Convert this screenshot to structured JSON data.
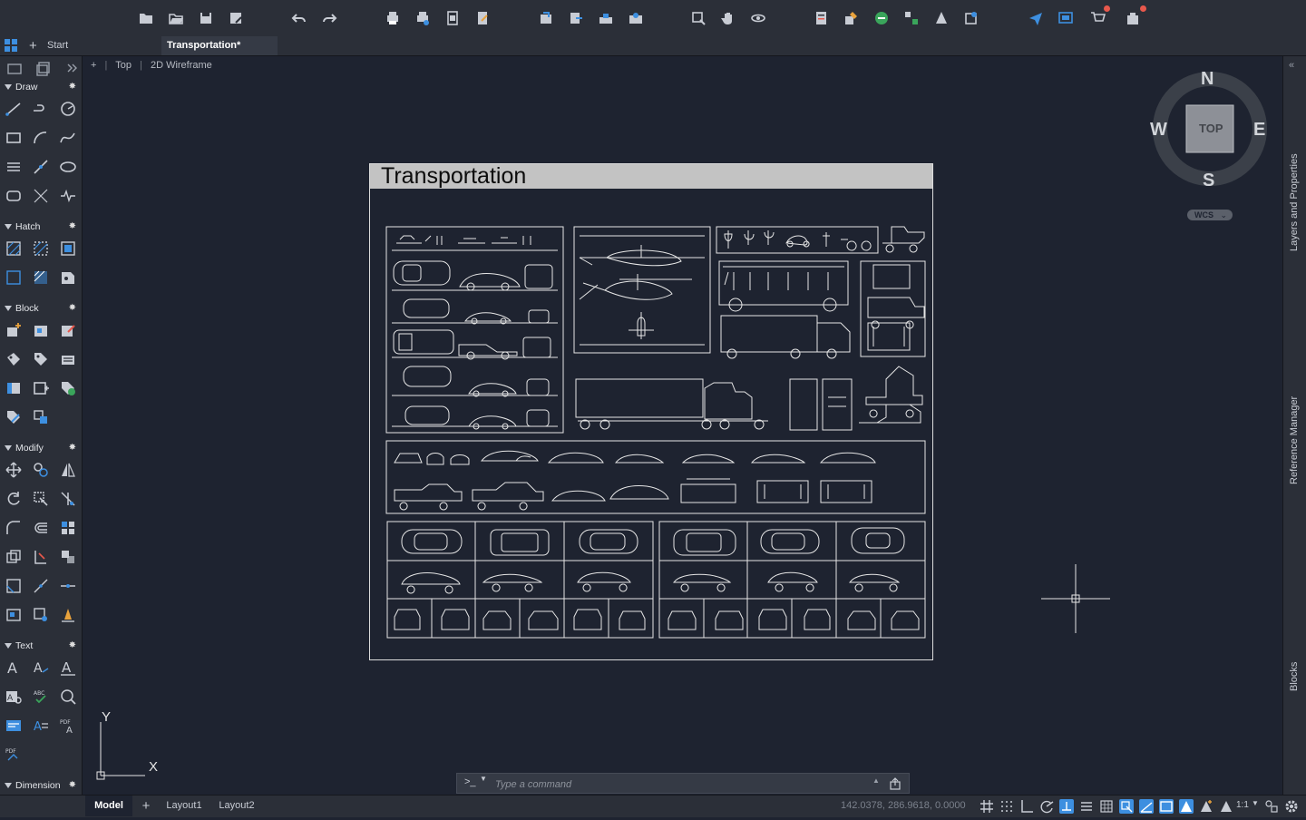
{
  "tabs": {
    "start": "Start",
    "active": "Transportation*",
    "new_tab_glyph": "+"
  },
  "viewport": {
    "plus": "+",
    "view": "Top",
    "style": "2D Wireframe"
  },
  "drawing": {
    "title": "Transportation"
  },
  "panels": {
    "draw": "Draw",
    "hatch": "Hatch",
    "block": "Block",
    "modify": "Modify",
    "text": "Text",
    "dimension": "Dimension"
  },
  "navigation": {
    "north": "N",
    "south": "S",
    "east": "E",
    "west": "W",
    "cube_face": "TOP",
    "ucs": "WCS"
  },
  "axis": {
    "x": "X",
    "y": "Y"
  },
  "side_palettes": {
    "layers": "Layers and Properties",
    "reference": "Reference Manager",
    "blocks": "Blocks"
  },
  "command": {
    "placeholder": "Type a command",
    "prompt": ">_"
  },
  "layouts": {
    "model": "Model",
    "layout1": "Layout1",
    "layout2": "Layout2",
    "add": "+"
  },
  "status": {
    "coords": "142.0378, 286.9618, 0.0000",
    "scale": "1:1"
  },
  "colors": {
    "background": "#1e2330",
    "panel": "#2b2f38",
    "accent_blue": "#3d8fe0",
    "notify": "#e8584c"
  }
}
